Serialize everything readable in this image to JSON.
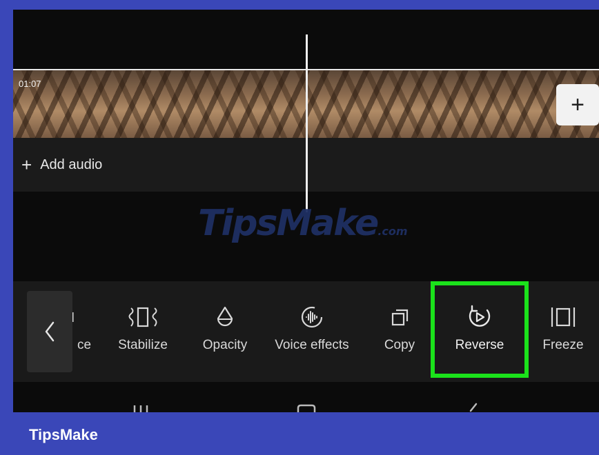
{
  "timeline": {
    "clip_time": "01:07",
    "add_clip_label": "+",
    "add_audio_label": "Add audio"
  },
  "toolbar": {
    "partial_label": "ce",
    "tools": [
      {
        "label": "Stabilize",
        "icon": "stabilize-icon"
      },
      {
        "label": "Opacity",
        "icon": "opacity-drop-icon"
      },
      {
        "label": "Voice effects",
        "icon": "voice-effects-icon"
      },
      {
        "label": "Copy",
        "icon": "copy-icon"
      },
      {
        "label": "Reverse",
        "icon": "reverse-icon"
      },
      {
        "label": "Freeze",
        "icon": "freeze-icon"
      }
    ]
  },
  "watermark": {
    "text": "TipsMake",
    "suffix": ".com"
  },
  "footer": {
    "brand": "TipsMake"
  },
  "colors": {
    "highlight": "#1be21b",
    "frame": "#3a47b8"
  }
}
